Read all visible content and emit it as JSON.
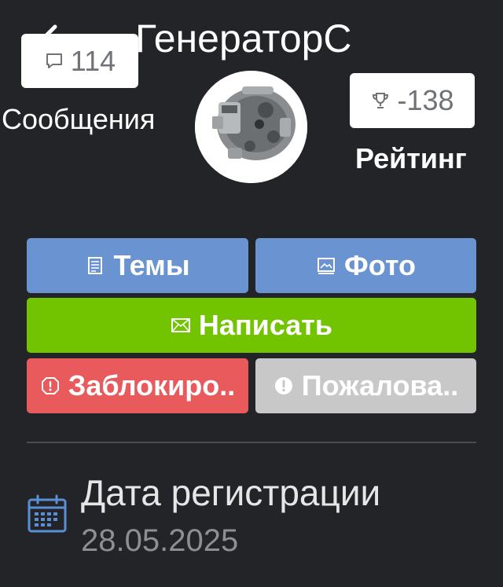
{
  "profile": {
    "username": "ГенераторС",
    "avatar_description": "",
    "stats": {
      "messages": {
        "count": "114",
        "label": "Сообщения",
        "icon": "speech-bubble-icon"
      },
      "rating": {
        "count": "-138",
        "label": "Рейтинг",
        "icon": "trophy-icon"
      }
    }
  },
  "actions": {
    "topics": "Темы",
    "photos": "Фото",
    "write": "Написать",
    "block": "Заблокиро..",
    "report": "Пожалова.."
  },
  "registration": {
    "title": "Дата регистрации",
    "date": "28.05.2025"
  },
  "colors": {
    "background": "#232427",
    "blue_button": "#6a93d2",
    "green_button": "#72c400",
    "red_button": "#e85a5c",
    "grey_button": "#c8c8c8",
    "calendar_icon": "#5a8fd6"
  }
}
